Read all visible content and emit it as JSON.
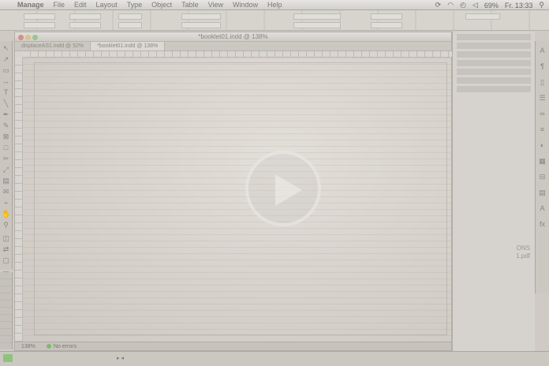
{
  "menubar": {
    "app_name": "Manage",
    "menus": [
      "File",
      "Edit",
      "Layout",
      "Type",
      "Object",
      "Table",
      "View",
      "Window",
      "Help"
    ],
    "battery": "69%",
    "clock": "Fr. 13:33"
  },
  "document": {
    "window_title": "*booklet01.indd @ 138%",
    "tabs": [
      "displaceAS1.indd @ 52%",
      "*booklet01.indd @ 138%"
    ]
  },
  "status": {
    "zoom": "138%",
    "errors": "No errors"
  },
  "panels": {
    "side_text_1": "ONS",
    "side_text_2": "1.pdf"
  },
  "colors": {
    "background": "#cfcbc4",
    "accent_green": "#8bbf7a",
    "accent_red": "#b77a6a"
  }
}
